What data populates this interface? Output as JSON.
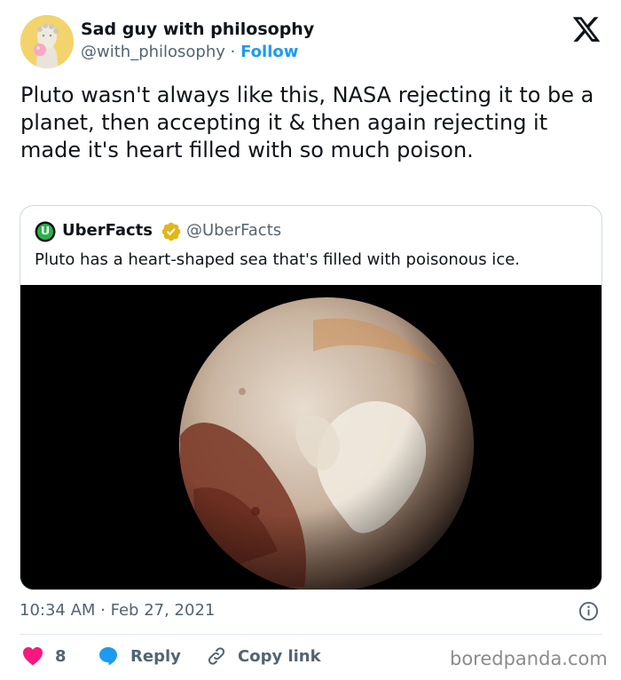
{
  "author": {
    "name": "Sad guy with philosophy",
    "handle": "@with_philosophy",
    "separator": " · ",
    "follow_label": "Follow",
    "avatar_icon": "statue-head-with-bubblegum-avatar"
  },
  "platform_icon": "x-logo-icon",
  "tweet": {
    "text": "Pluto wasn't always like this, NASA rejecting it to be a planet, then accepting it & then again rejecting it made it's heart filled with so much poison."
  },
  "quote": {
    "name": "UberFacts",
    "handle": "@UberFacts",
    "verified_badge": "gold-check-badge-icon",
    "avatar_icon": "uberfacts-logo-icon",
    "text": "Pluto has a heart-shaped sea that's filled with poisonous ice.",
    "image_subject": "pluto-planet-photo"
  },
  "meta": {
    "timestamp": "10:34 AM · Feb 27, 2021"
  },
  "actions": {
    "like_count": "8",
    "reply_label": "Reply",
    "copy_link_label": "Copy link"
  },
  "watermark": "boredpanda.com",
  "colors": {
    "accent": "#1d9bf0",
    "like": "#f91880",
    "muted_text": "#536471",
    "border": "#cfd9de"
  }
}
